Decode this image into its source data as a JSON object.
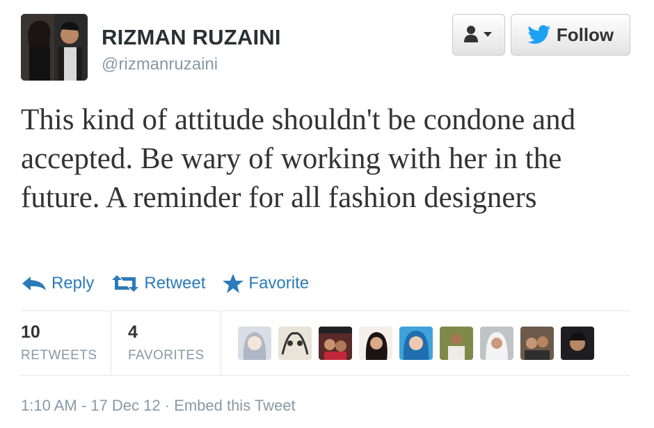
{
  "header": {
    "display_name": "RIZMAN RUZAINI",
    "username": "@rizmanruzaini",
    "user_menu_icon": "user-dropdown-icon",
    "follow_label": "Follow",
    "follow_icon": "bird-icon"
  },
  "tweet": {
    "text": "This kind of attitude shouldn't be condone and accepted. Be wary of working with her in the future. A reminder for all fashion designers"
  },
  "actions": {
    "reply": "Reply",
    "retweet": "Retweet",
    "favorite": "Favorite"
  },
  "stats": {
    "retweets_count": "10",
    "retweets_label": "RETWEETS",
    "favorites_count": "4",
    "favorites_label": "FAVORITES"
  },
  "meta": {
    "timestamp": "1:10 AM - 17 Dec 12",
    "separator": "·",
    "embed_label": "Embed this Tweet"
  },
  "colors": {
    "link_blue": "#2b7bb9",
    "follow_bird": "#1da1f2",
    "muted": "#8899a6"
  }
}
